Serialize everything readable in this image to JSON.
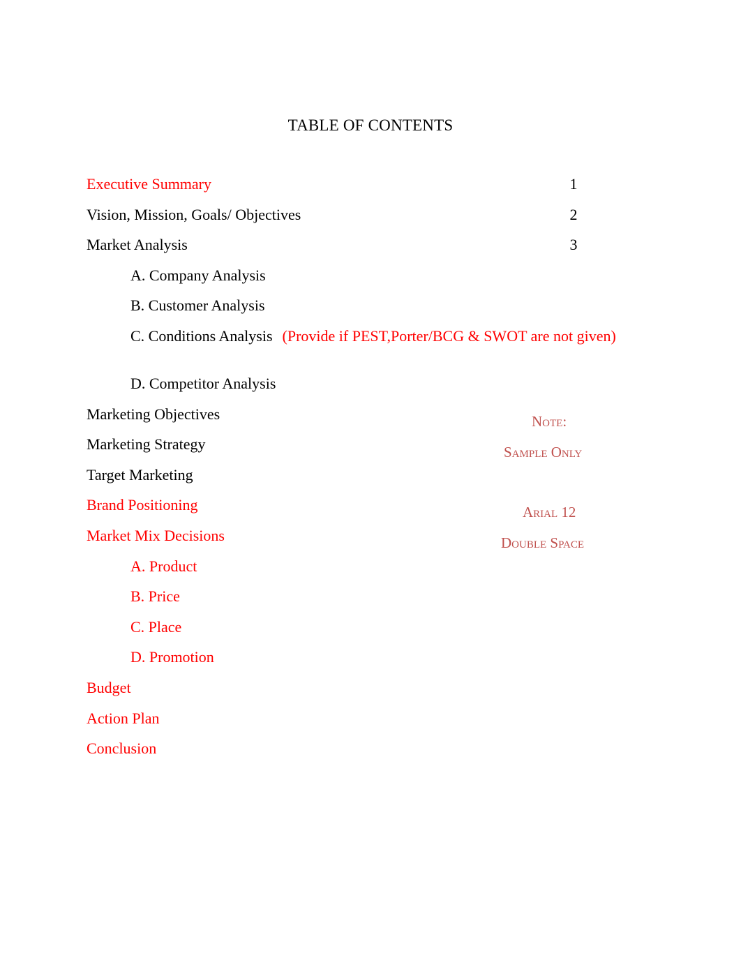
{
  "document": {
    "title": "TABLE OF CONTENTS"
  },
  "colors": {
    "highlight_red": "#ff0000",
    "note_red": "#c0504d",
    "body_black": "#000000",
    "page_background": "#ffffff"
  },
  "toc": {
    "entries": [
      {
        "label": "Executive Summary",
        "page": "1",
        "color": "red",
        "level": "main"
      },
      {
        "label": "Vision, Mission, Goals/ Objectives",
        "page": "2",
        "color": "black",
        "level": "main"
      },
      {
        "label": "Market Analysis",
        "page": "3",
        "color": "black",
        "level": "main"
      },
      {
        "label": "A. Company Analysis",
        "page": "",
        "color": "black",
        "level": "sub"
      },
      {
        "label": "B. Customer Analysis",
        "page": "",
        "color": "black",
        "level": "sub"
      },
      {
        "label": "C. Conditions Analysis",
        "page": "",
        "color": "black",
        "level": "sub",
        "annotation": "(Provide if PEST,Porter/BCG & SWOT are not given)"
      },
      {
        "label": "D. Competitor Analysis",
        "page": "",
        "color": "black",
        "level": "sub"
      },
      {
        "label": "Marketing Objectives",
        "page": "",
        "color": "black",
        "level": "main"
      },
      {
        "label": "Marketing Strategy",
        "page": "",
        "color": "black",
        "level": "main"
      },
      {
        "label": "Target Marketing",
        "page": "",
        "color": "black",
        "level": "main"
      },
      {
        "label": "Brand Positioning",
        "page": "",
        "color": "red",
        "level": "main"
      },
      {
        "label": "Market Mix Decisions",
        "page": "",
        "color": "red",
        "level": "main"
      },
      {
        "label": "A. Product",
        "page": "",
        "color": "red",
        "level": "sub"
      },
      {
        "label": "B. Price",
        "page": "",
        "color": "red",
        "level": "sub"
      },
      {
        "label": "C. Place",
        "page": "",
        "color": "red",
        "level": "sub"
      },
      {
        "label": "D. Promotion",
        "page": "",
        "color": "red",
        "level": "sub"
      },
      {
        "label": "Budget",
        "page": "",
        "color": "red",
        "level": "main"
      },
      {
        "label": "Action Plan",
        "page": "",
        "color": "red",
        "level": "main"
      },
      {
        "label": "Conclusion",
        "page": "",
        "color": "red",
        "level": "main"
      }
    ]
  },
  "side_note": {
    "heading": "Note:",
    "line_sample": "Sample Only",
    "line_font": "Arial 12",
    "line_spacing": "Double Space"
  }
}
